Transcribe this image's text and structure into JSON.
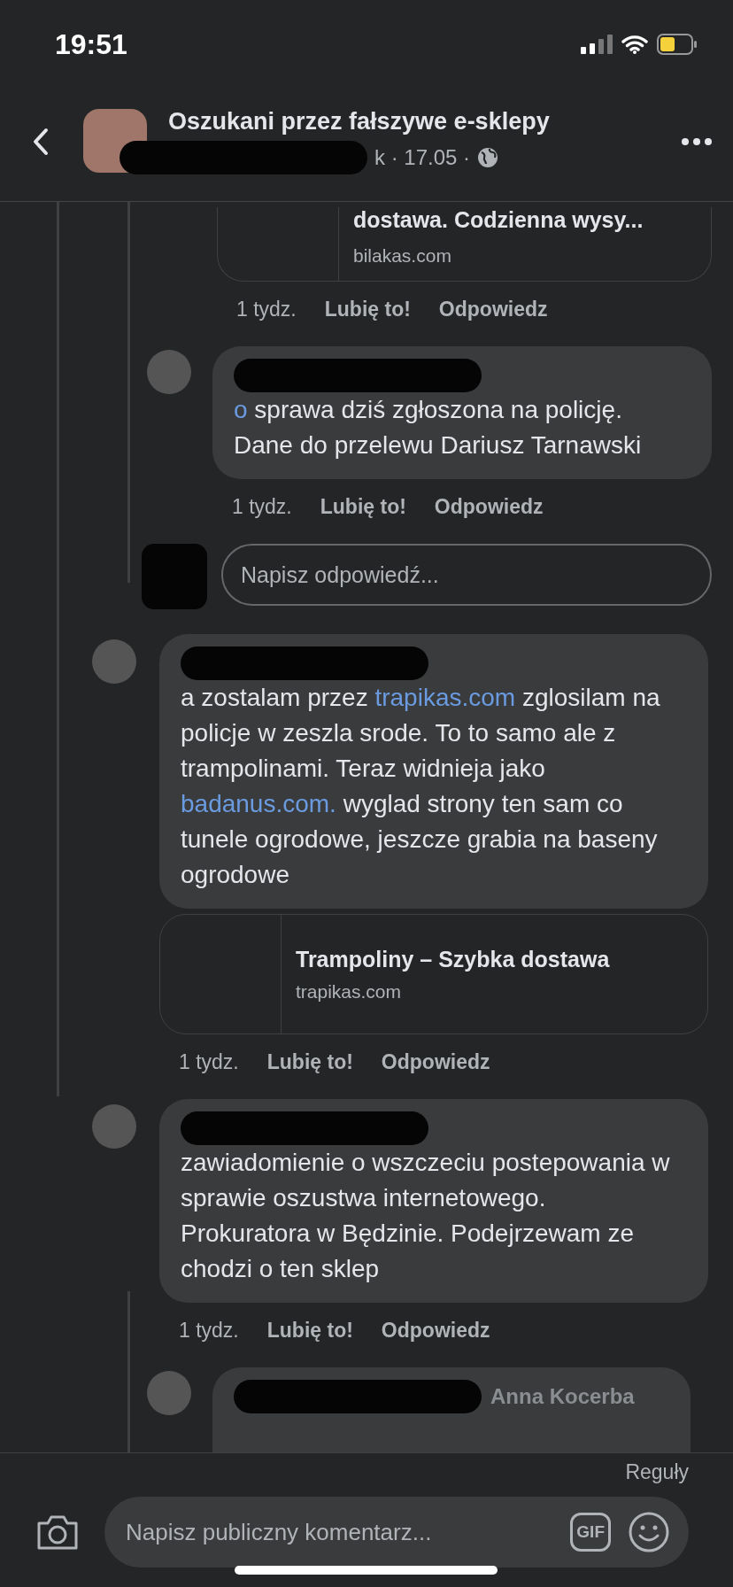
{
  "status_bar": {
    "time": "19:51"
  },
  "header": {
    "title": "Oszukani przez fałszywe e-sklepy",
    "meta": "k · 17.05 ·"
  },
  "comments": [
    {
      "replies": [
        {
          "link_preview": {
            "title": "dostawa. Codzienna wysy...",
            "domain": "bilakas.com"
          },
          "actions": {
            "time": "1 tydz.",
            "like": "Lubię to!",
            "reply": "Odpowiedz"
          }
        },
        {
          "parts": [
            {
              "text": "o",
              "link": true
            },
            {
              "text": " sprawa dziś zgłoszona na policję. Dane do przelewu Dariusz Tarnawski",
              "link": false
            }
          ],
          "actions": {
            "time": "1 tydz.",
            "like": "Lubię to!",
            "reply": "Odpowiedz"
          }
        }
      ],
      "reply_placeholder": "Napisz odpowiedź..."
    },
    {
      "parts": [
        {
          "text": "a zostalam przez ",
          "link": false
        },
        {
          "text": "trapikas.com",
          "link": true
        },
        {
          "text": " zglosilam na policje w zeszla srode. To to samo ale z trampolinami. Teraz widnieja jako ",
          "link": false
        },
        {
          "text": "badanus.com.",
          "link": true
        },
        {
          "text": " wyglad strony ten sam co tunele ogrodowe, jeszcze grabia na baseny ogrodowe",
          "link": false
        }
      ],
      "link_preview": {
        "title": "Trampoliny – Szybka dostawa",
        "domain": "trapikas.com"
      },
      "actions": {
        "time": "1 tydz.",
        "like": "Lubię to!",
        "reply": "Odpowiedz"
      }
    },
    {
      "parts": [
        {
          "text": "zawiadomienie o wszczeciu postepowania w sprawie oszustwa internetowego. Prokuratora w Będzinie. Podejrzewam ze chodzi o ten sklep",
          "link": false
        }
      ],
      "actions": {
        "time": "1 tydz.",
        "like": "Lubię to!",
        "reply": "Odpowiedz"
      },
      "replies": [
        {
          "name": "Anna Kocerba"
        }
      ]
    }
  ],
  "footer": {
    "rules": "Reguły",
    "placeholder": "Napisz publiczny komentarz...",
    "gif": "GIF"
  }
}
